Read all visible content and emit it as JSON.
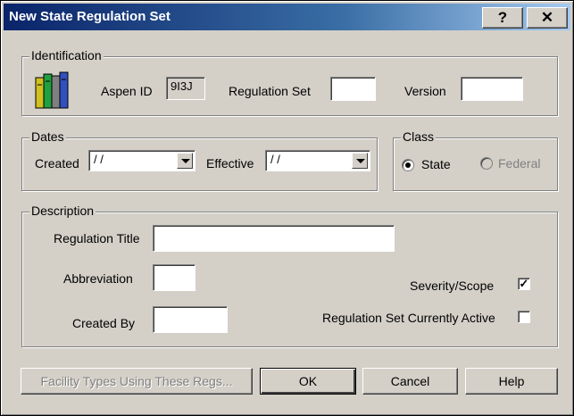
{
  "window": {
    "title": "New State Regulation Set",
    "help_btn": "?",
    "close_btn": "✕"
  },
  "identification": {
    "group_label": "Identification",
    "aspen_id_label": "Aspen ID",
    "aspen_id_value": "9I3J",
    "regulation_set_label": "Regulation Set",
    "regulation_set_value": "",
    "version_label": "Version",
    "version_value": "",
    "icon": "books-icon"
  },
  "dates": {
    "group_label": "Dates",
    "created_label": "Created",
    "created_value": "/ /",
    "effective_label": "Effective",
    "effective_value": "/ /"
  },
  "class": {
    "group_label": "Class",
    "state_label": "State",
    "federal_label": "Federal",
    "selected": "State"
  },
  "description": {
    "group_label": "Description",
    "regulation_title_label": "Regulation Title",
    "regulation_title_value": "",
    "abbreviation_label": "Abbreviation",
    "abbreviation_value": "",
    "created_by_label": "Created By",
    "created_by_value": "",
    "severity_scope_label": "Severity/Scope",
    "severity_scope_checked": true,
    "active_label": "Regulation Set Currently Active",
    "active_checked": false,
    "check_mark": "✓"
  },
  "buttons": {
    "facility_types": "Facility Types Using These Regs...",
    "ok": "OK",
    "cancel": "Cancel",
    "help": "Help"
  },
  "colors": {
    "titlebar_start": "#0a246a",
    "titlebar_end": "#a6caf0",
    "face": "#d4d0c8"
  }
}
